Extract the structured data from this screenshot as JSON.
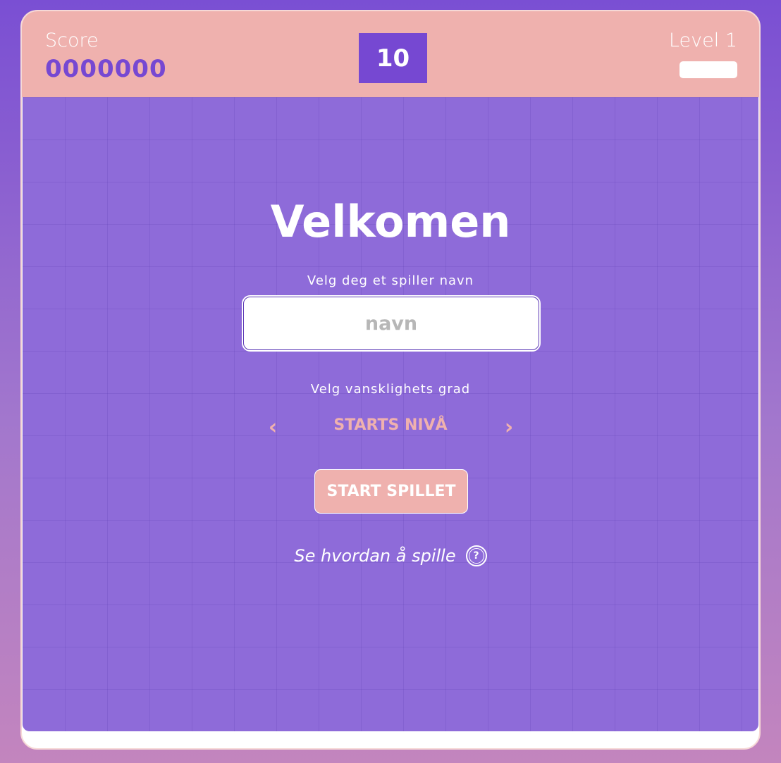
{
  "header": {
    "score_label": "Score",
    "score_value": "0000000",
    "timer_value": "10",
    "level_label": "Level 1"
  },
  "welcome": {
    "title": "Velkomen",
    "name_label": "Velg deg et spiller navn",
    "name_placeholder": "navn",
    "difficulty_label": "Velg vansklighets grad",
    "difficulty_value": "STARTS NIVÅ",
    "prev_icon": "chevron-left-icon",
    "next_icon": "chevron-right-icon",
    "start_button": "START SPILLET",
    "howto_text": "Se hvordan å spille",
    "help_icon": "?"
  },
  "colors": {
    "accent_purple": "#7648d2",
    "accent_pink": "#efb1ae",
    "board": "#8e6bd9"
  }
}
